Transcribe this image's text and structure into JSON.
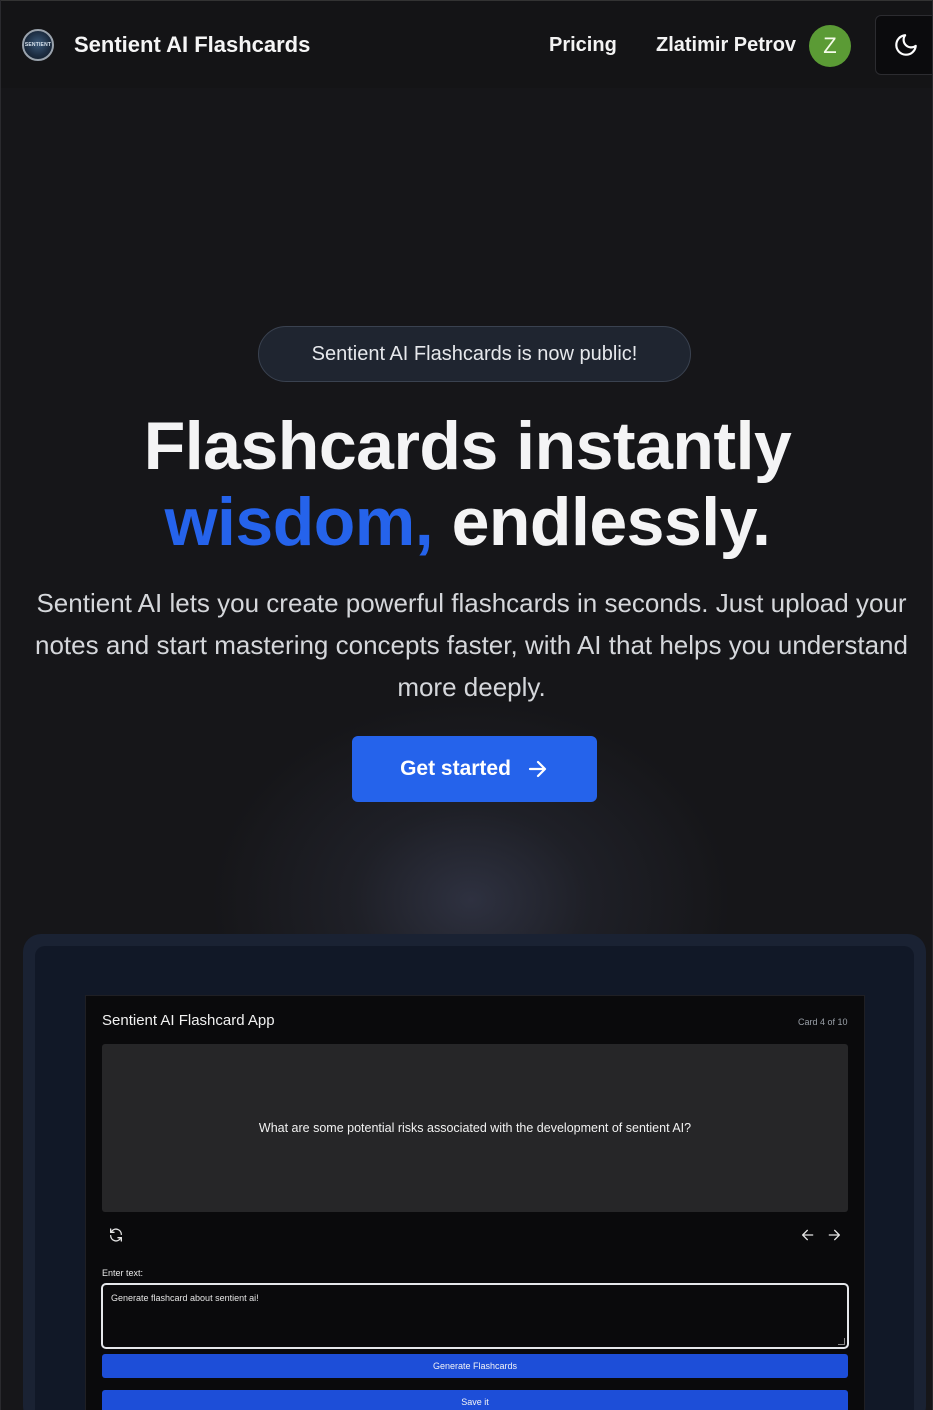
{
  "nav": {
    "logo_text": "SENTIENT",
    "brand": "Sentient AI Flashcards",
    "pricing": "Pricing",
    "user_name": "Zlatimir Petrov",
    "avatar_initial": "Z",
    "theme_icon": "moon-icon"
  },
  "hero": {
    "announcement": "Sentient AI Flashcards is now public!",
    "headline_line1": "Flashcards instantly",
    "headline_accent": "wisdom,",
    "headline_rest": " endlessly.",
    "subtitle": "Sentient AI lets you create powerful flashcards in seconds. Just upload your notes and start mastering concepts faster, with AI that helps you understand more deeply.",
    "cta_label": "Get started",
    "cta_icon": "arrow-right-icon"
  },
  "app": {
    "title": "Sentient AI Flashcard App",
    "card_counter": "Card 4 of 10",
    "card_question": "What are some potential risks associated with the development of sentient AI?",
    "input_label": "Enter text:",
    "input_value": "Generate flashcard about sentient ai!",
    "generate_label": "Generate Flashcards",
    "save_label": "Save it"
  },
  "colors": {
    "accent": "#2563eb",
    "avatar": "#5b9b35",
    "background": "#161619"
  }
}
